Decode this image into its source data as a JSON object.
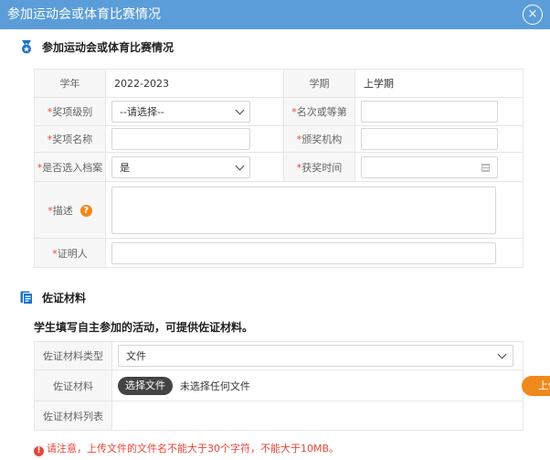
{
  "dialog": {
    "title": "参加运动会或体育比赛情况",
    "close_glyph": "×"
  },
  "section1": {
    "title": "参加运动会或体育比赛情况",
    "icon": "medal-icon"
  },
  "form": {
    "required_mark": "*",
    "school_year_label": "学年",
    "school_year_value": "2022-2023",
    "semester_label": "学期",
    "semester_value": "上学期",
    "award_level_label": "奖项级别",
    "award_level_value": "--请选择--",
    "rank_label": "名次或等第",
    "rank_value": "",
    "award_name_label": "奖项名称",
    "award_name_value": "",
    "issuer_label": "颁奖机构",
    "issuer_value": "",
    "archive_label": "是否选入档案",
    "archive_value": "是",
    "award_time_label": "获奖时间",
    "award_time_value": "",
    "description_label": "描述",
    "description_help_glyph": "?",
    "description_value": "",
    "witness_label": "证明人",
    "witness_value": ""
  },
  "section2": {
    "title": "佐证材料",
    "icon": "document-icon",
    "subtitle": "学生填写自主参加的活动，可提供佐证材料。"
  },
  "evidence": {
    "type_label": "佐证材料类型",
    "type_value": "文件",
    "material_label": "佐证材料",
    "choose_file_label": "选择文件",
    "no_file_text": "未选择任何文件",
    "upload_label": "上传",
    "list_label": "佐证材料列表"
  },
  "notice": {
    "glyph": "!",
    "text": "请注意，上传文件的文件名不能大于30个字符，不能大于10MB。"
  },
  "colors": {
    "titlebar": "#5b9dd9",
    "accent_orange": "#f0891c",
    "required_red": "#e8463b",
    "label_bg": "#f7f7f7"
  }
}
